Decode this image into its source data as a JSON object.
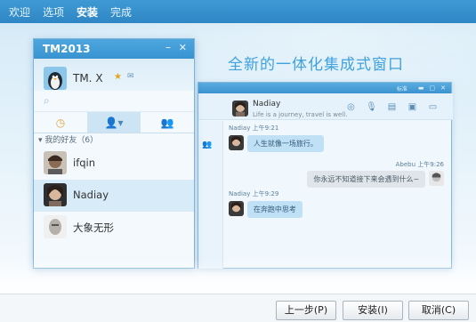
{
  "steps": [
    {
      "label": "欢迎",
      "active": false
    },
    {
      "label": "选项",
      "active": false
    },
    {
      "label": "安装",
      "active": true
    },
    {
      "label": "完成",
      "active": false
    }
  ],
  "headline": "全新的一体化集成式窗口",
  "panel": {
    "title": "TM2013",
    "min_glyph": "–",
    "close_glyph": "✕",
    "profile_name": "TM. X",
    "group_header": "▾ 我的好友（6）",
    "contacts": [
      {
        "name": "ifqin",
        "selected": false
      },
      {
        "name": "Nadiay",
        "selected": true
      },
      {
        "name": "大象无形",
        "selected": false
      }
    ],
    "icons": {
      "search": "search-icon",
      "clock": "clock-icon",
      "user": "contacts-icon",
      "group": "group-icon",
      "star": "star-icon",
      "mail": "mail-icon"
    }
  },
  "chat": {
    "titlebar_text": "标准",
    "contact_name": "Nadiay",
    "signature": "Life is a journey, travel is well.",
    "messages": [
      {
        "sender": "Nadiay",
        "time": "上午9:21",
        "text": "人生就像一场旅行。",
        "direction": "in"
      },
      {
        "sender": "Abebu",
        "time": "上午9:26",
        "text": "你永远不知道接下来会遇到什么~",
        "direction": "out"
      },
      {
        "sender": "Nadiay",
        "time": "上午9:29",
        "text": "在奔跑中思考",
        "direction": "in"
      }
    ]
  },
  "buttons": {
    "back": "上一步(P)",
    "install": "安装(I)",
    "cancel": "取消(C)"
  },
  "colors": {
    "accent": "#3893d0",
    "headline": "#3fa1dd",
    "bubble_in": "#bfe0f5",
    "bubble_out": "#dfe5ea"
  }
}
